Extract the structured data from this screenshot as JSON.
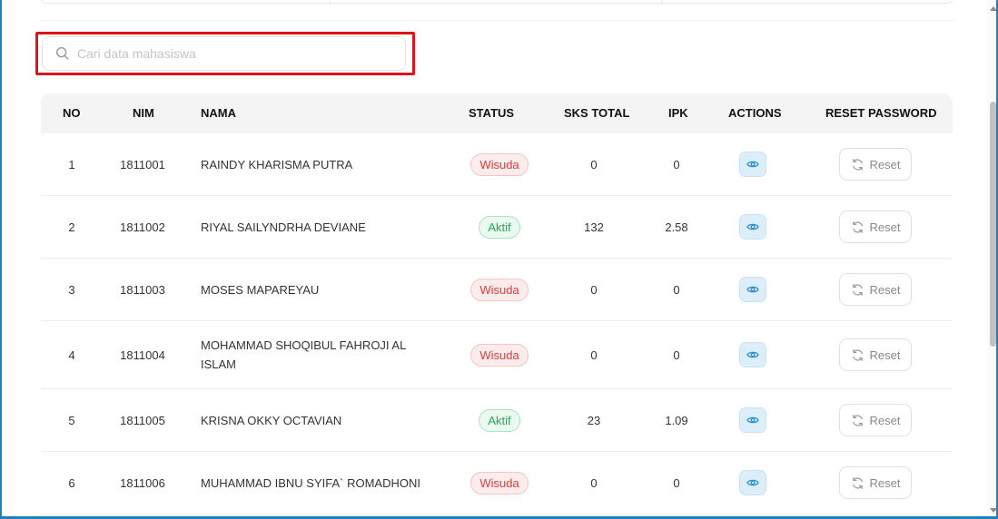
{
  "search": {
    "placeholder": "Cari data mahasiswa"
  },
  "table": {
    "headers": {
      "no": "NO",
      "nim": "NIM",
      "nama": "NAMA",
      "status": "STATUS",
      "sks_total": "SKS TOTAL",
      "ipk": "IPK",
      "actions": "ACTIONS",
      "reset_password": "RESET PASSWORD"
    },
    "reset_label": "Reset",
    "rows": [
      {
        "no": "1",
        "nim": "1811001",
        "nama": "RAINDY KHARISMA PUTRA",
        "status": "Wisuda",
        "sks": "0",
        "ipk": "0"
      },
      {
        "no": "2",
        "nim": "1811002",
        "nama": "RIYAL SAILYNDRHA DEVIANE",
        "status": "Aktif",
        "sks": "132",
        "ipk": "2.58"
      },
      {
        "no": "3",
        "nim": "1811003",
        "nama": "MOSES MAPAREYAU",
        "status": "Wisuda",
        "sks": "0",
        "ipk": "0"
      },
      {
        "no": "4",
        "nim": "1811004",
        "nama": "MOHAMMAD SHOQIBUL FAHROJI AL ISLAM",
        "status": "Wisuda",
        "sks": "0",
        "ipk": "0"
      },
      {
        "no": "5",
        "nim": "1811005",
        "nama": "KRISNA OKKY OCTAVIAN",
        "status": "Aktif",
        "sks": "23",
        "ipk": "1.09"
      },
      {
        "no": "6",
        "nim": "1811006",
        "nama": "MUHAMMAD IBNU SYIFA` ROMADHONI",
        "status": "Wisuda",
        "sks": "0",
        "ipk": "0"
      }
    ]
  },
  "colors": {
    "accent": "#1f7fc4",
    "highlight": "#e0131b",
    "wisuda": "#e23b3b",
    "aktif": "#2aa55b"
  }
}
